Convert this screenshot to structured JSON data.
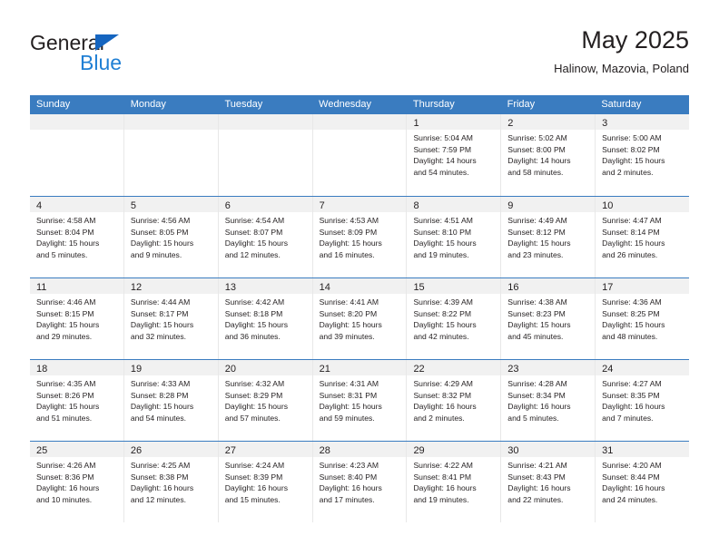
{
  "logo": {
    "primary_text": "General",
    "secondary_text": "Blue",
    "primary_color": "#231f20",
    "secondary_color": "#1f7fd4",
    "triangle_color": "#1565c0"
  },
  "header": {
    "title": "May 2025",
    "subtitle": "Halinow, Mazovia, Poland"
  },
  "theme": {
    "header_row_bg": "#3a7cc0",
    "header_row_text": "#ffffff",
    "daynum_strip_bg": "#f1f1f1",
    "week_separator": "#3a7cc0",
    "cell_separator": "#e8e8e8"
  },
  "calendar": {
    "day_headers": [
      "Sunday",
      "Monday",
      "Tuesday",
      "Wednesday",
      "Thursday",
      "Friday",
      "Saturday"
    ],
    "weeks": [
      [
        {
          "day": "",
          "lines": []
        },
        {
          "day": "",
          "lines": []
        },
        {
          "day": "",
          "lines": []
        },
        {
          "day": "",
          "lines": []
        },
        {
          "day": "1",
          "lines": [
            "Sunrise: 5:04 AM",
            "Sunset: 7:59 PM",
            "Daylight: 14 hours",
            "and 54 minutes."
          ]
        },
        {
          "day": "2",
          "lines": [
            "Sunrise: 5:02 AM",
            "Sunset: 8:00 PM",
            "Daylight: 14 hours",
            "and 58 minutes."
          ]
        },
        {
          "day": "3",
          "lines": [
            "Sunrise: 5:00 AM",
            "Sunset: 8:02 PM",
            "Daylight: 15 hours",
            "and 2 minutes."
          ]
        }
      ],
      [
        {
          "day": "4",
          "lines": [
            "Sunrise: 4:58 AM",
            "Sunset: 8:04 PM",
            "Daylight: 15 hours",
            "and 5 minutes."
          ]
        },
        {
          "day": "5",
          "lines": [
            "Sunrise: 4:56 AM",
            "Sunset: 8:05 PM",
            "Daylight: 15 hours",
            "and 9 minutes."
          ]
        },
        {
          "day": "6",
          "lines": [
            "Sunrise: 4:54 AM",
            "Sunset: 8:07 PM",
            "Daylight: 15 hours",
            "and 12 minutes."
          ]
        },
        {
          "day": "7",
          "lines": [
            "Sunrise: 4:53 AM",
            "Sunset: 8:09 PM",
            "Daylight: 15 hours",
            "and 16 minutes."
          ]
        },
        {
          "day": "8",
          "lines": [
            "Sunrise: 4:51 AM",
            "Sunset: 8:10 PM",
            "Daylight: 15 hours",
            "and 19 minutes."
          ]
        },
        {
          "day": "9",
          "lines": [
            "Sunrise: 4:49 AM",
            "Sunset: 8:12 PM",
            "Daylight: 15 hours",
            "and 23 minutes."
          ]
        },
        {
          "day": "10",
          "lines": [
            "Sunrise: 4:47 AM",
            "Sunset: 8:14 PM",
            "Daylight: 15 hours",
            "and 26 minutes."
          ]
        }
      ],
      [
        {
          "day": "11",
          "lines": [
            "Sunrise: 4:46 AM",
            "Sunset: 8:15 PM",
            "Daylight: 15 hours",
            "and 29 minutes."
          ]
        },
        {
          "day": "12",
          "lines": [
            "Sunrise: 4:44 AM",
            "Sunset: 8:17 PM",
            "Daylight: 15 hours",
            "and 32 minutes."
          ]
        },
        {
          "day": "13",
          "lines": [
            "Sunrise: 4:42 AM",
            "Sunset: 8:18 PM",
            "Daylight: 15 hours",
            "and 36 minutes."
          ]
        },
        {
          "day": "14",
          "lines": [
            "Sunrise: 4:41 AM",
            "Sunset: 8:20 PM",
            "Daylight: 15 hours",
            "and 39 minutes."
          ]
        },
        {
          "day": "15",
          "lines": [
            "Sunrise: 4:39 AM",
            "Sunset: 8:22 PM",
            "Daylight: 15 hours",
            "and 42 minutes."
          ]
        },
        {
          "day": "16",
          "lines": [
            "Sunrise: 4:38 AM",
            "Sunset: 8:23 PM",
            "Daylight: 15 hours",
            "and 45 minutes."
          ]
        },
        {
          "day": "17",
          "lines": [
            "Sunrise: 4:36 AM",
            "Sunset: 8:25 PM",
            "Daylight: 15 hours",
            "and 48 minutes."
          ]
        }
      ],
      [
        {
          "day": "18",
          "lines": [
            "Sunrise: 4:35 AM",
            "Sunset: 8:26 PM",
            "Daylight: 15 hours",
            "and 51 minutes."
          ]
        },
        {
          "day": "19",
          "lines": [
            "Sunrise: 4:33 AM",
            "Sunset: 8:28 PM",
            "Daylight: 15 hours",
            "and 54 minutes."
          ]
        },
        {
          "day": "20",
          "lines": [
            "Sunrise: 4:32 AM",
            "Sunset: 8:29 PM",
            "Daylight: 15 hours",
            "and 57 minutes."
          ]
        },
        {
          "day": "21",
          "lines": [
            "Sunrise: 4:31 AM",
            "Sunset: 8:31 PM",
            "Daylight: 15 hours",
            "and 59 minutes."
          ]
        },
        {
          "day": "22",
          "lines": [
            "Sunrise: 4:29 AM",
            "Sunset: 8:32 PM",
            "Daylight: 16 hours",
            "and 2 minutes."
          ]
        },
        {
          "day": "23",
          "lines": [
            "Sunrise: 4:28 AM",
            "Sunset: 8:34 PM",
            "Daylight: 16 hours",
            "and 5 minutes."
          ]
        },
        {
          "day": "24",
          "lines": [
            "Sunrise: 4:27 AM",
            "Sunset: 8:35 PM",
            "Daylight: 16 hours",
            "and 7 minutes."
          ]
        }
      ],
      [
        {
          "day": "25",
          "lines": [
            "Sunrise: 4:26 AM",
            "Sunset: 8:36 PM",
            "Daylight: 16 hours",
            "and 10 minutes."
          ]
        },
        {
          "day": "26",
          "lines": [
            "Sunrise: 4:25 AM",
            "Sunset: 8:38 PM",
            "Daylight: 16 hours",
            "and 12 minutes."
          ]
        },
        {
          "day": "27",
          "lines": [
            "Sunrise: 4:24 AM",
            "Sunset: 8:39 PM",
            "Daylight: 16 hours",
            "and 15 minutes."
          ]
        },
        {
          "day": "28",
          "lines": [
            "Sunrise: 4:23 AM",
            "Sunset: 8:40 PM",
            "Daylight: 16 hours",
            "and 17 minutes."
          ]
        },
        {
          "day": "29",
          "lines": [
            "Sunrise: 4:22 AM",
            "Sunset: 8:41 PM",
            "Daylight: 16 hours",
            "and 19 minutes."
          ]
        },
        {
          "day": "30",
          "lines": [
            "Sunrise: 4:21 AM",
            "Sunset: 8:43 PM",
            "Daylight: 16 hours",
            "and 22 minutes."
          ]
        },
        {
          "day": "31",
          "lines": [
            "Sunrise: 4:20 AM",
            "Sunset: 8:44 PM",
            "Daylight: 16 hours",
            "and 24 minutes."
          ]
        }
      ]
    ]
  }
}
